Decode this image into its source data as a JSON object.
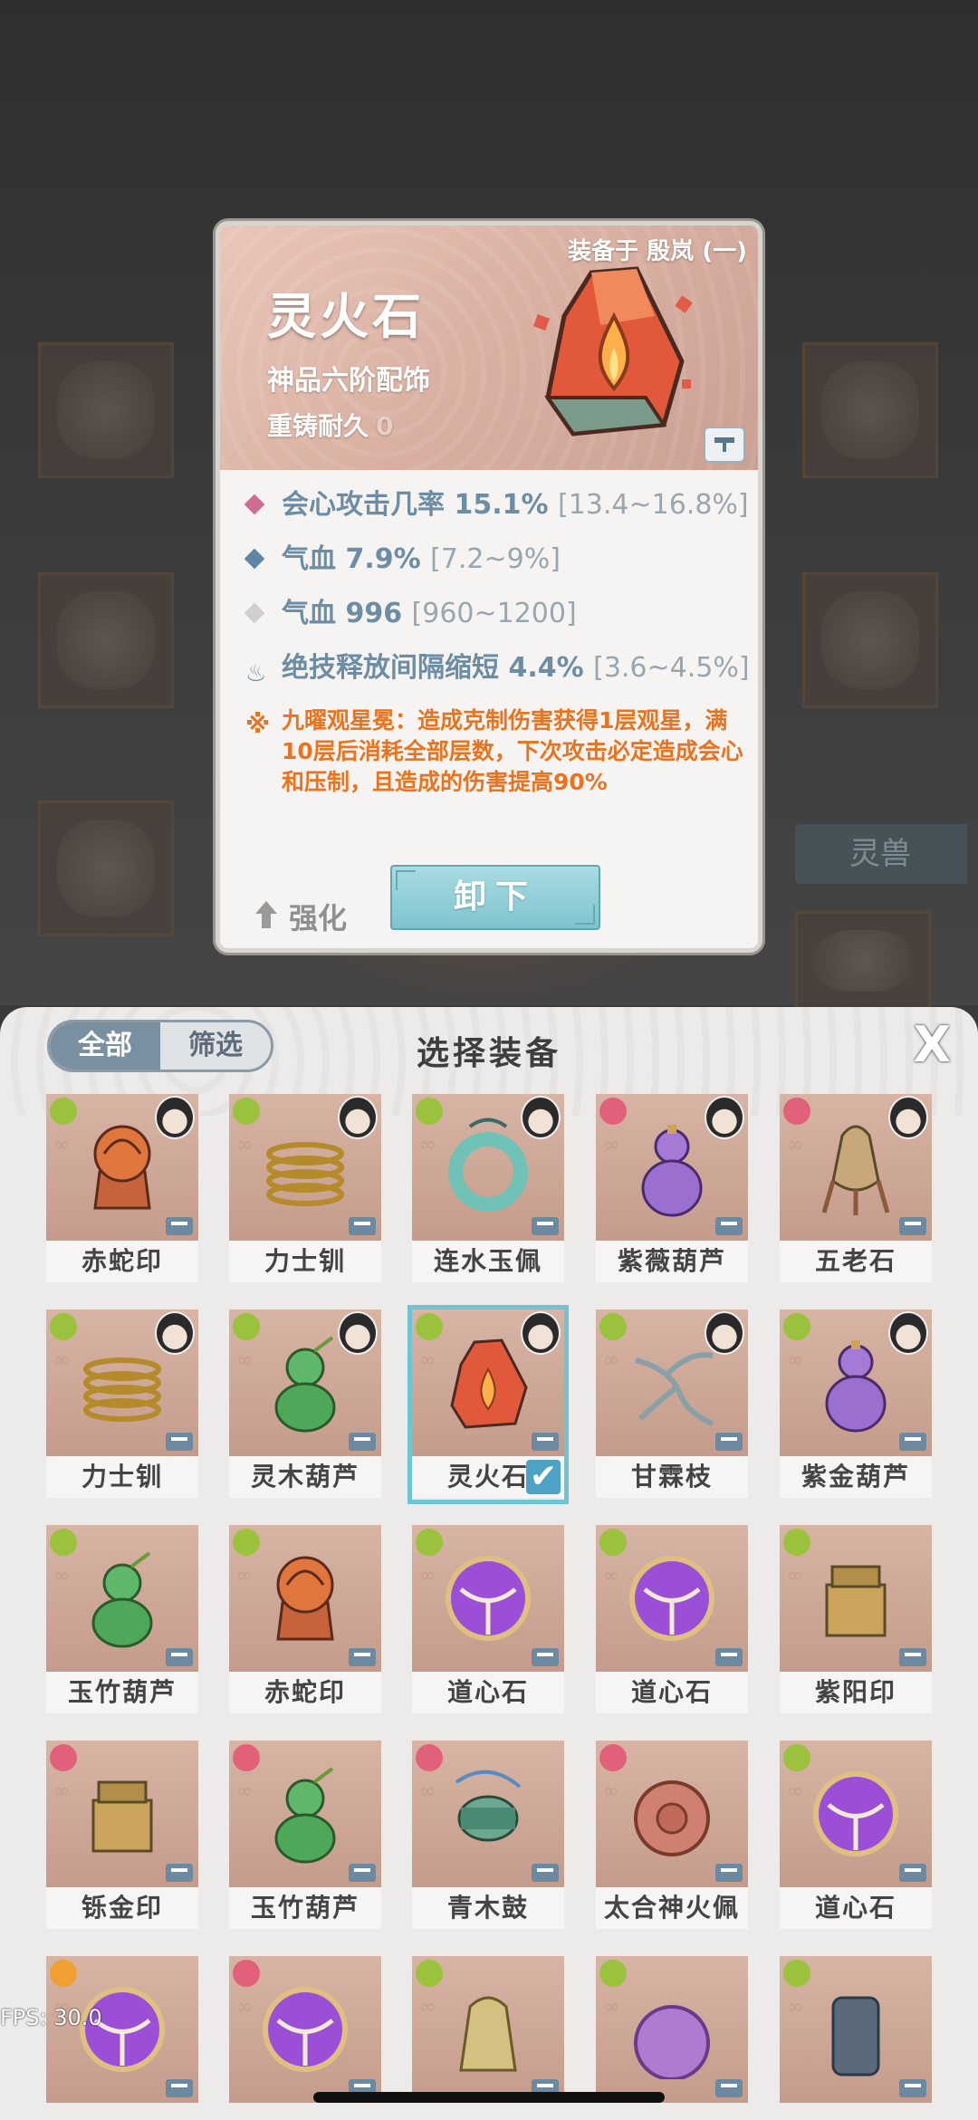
{
  "detail": {
    "equipped_by": "装备于 殷岚 (一)",
    "title": "灵火石",
    "grade": "神品六阶配饰",
    "durability_label": "重铸耐久",
    "durability_value": "0",
    "stats": [
      {
        "label": "会心攻击几率 15.1%",
        "range": "[13.4~16.8%]",
        "icon": "pink-diamond-icon",
        "color": "#d06b92"
      },
      {
        "label": "气血 7.9%",
        "range": "[7.2~9%]",
        "icon": "blue-diamond-icon",
        "color": "#5f86a8"
      },
      {
        "label": "气血 996",
        "range": "[960~1200]",
        "icon": "gray-diamond-icon",
        "color": "#cfcfcf"
      },
      {
        "label": "绝技释放间隔缩短 4.4%",
        "range": "[3.6~4.5%]",
        "icon": "flame-icon",
        "color": "#6d8da5"
      }
    ],
    "effect": "九曜观星冕：造成克制伤害获得1层观星，满10层后消耗全部层数，下次攻击必定造成会心和压制，且造成的伤害提高90%",
    "upgrade_label": "强化",
    "unequip_label": "卸下"
  },
  "background": {
    "side_tab": "灵兽"
  },
  "sheet": {
    "tab_all": "全部",
    "tab_filter": "筛选",
    "title": "选择装备",
    "close": "X",
    "items": [
      {
        "name": "赤蛇印",
        "grade_color": "#9ac23c",
        "avatar": true,
        "art": "orange-seal"
      },
      {
        "name": "力士钏",
        "grade_color": "#9ac23c",
        "avatar": true,
        "art": "gold-coil"
      },
      {
        "name": "连水玉佩",
        "grade_color": "#9ac23c",
        "avatar": true,
        "art": "jade-ring"
      },
      {
        "name": "紫薇葫芦",
        "grade_color": "#e2617a",
        "avatar": true,
        "art": "purple-gourd"
      },
      {
        "name": "五老石",
        "grade_color": "#e2617a",
        "avatar": true,
        "art": "yellow-stone"
      },
      {
        "name": "力士钏",
        "grade_color": "#9ac23c",
        "avatar": true,
        "art": "gold-coil"
      },
      {
        "name": "灵木葫芦",
        "grade_color": "#9ac23c",
        "avatar": true,
        "art": "green-gourd"
      },
      {
        "name": "灵火石",
        "grade_color": "#9ac23c",
        "avatar": true,
        "art": "fire-stone",
        "selected": true
      },
      {
        "name": "甘霖枝",
        "grade_color": "#9ac23c",
        "avatar": true,
        "art": "branch"
      },
      {
        "name": "紫金葫芦",
        "grade_color": "#9ac23c",
        "avatar": true,
        "art": "purple-gourd"
      },
      {
        "name": "玉竹葫芦",
        "grade_color": "#9ac23c",
        "avatar": false,
        "art": "green-gourd"
      },
      {
        "name": "赤蛇印",
        "grade_color": "#9ac23c",
        "avatar": false,
        "art": "orange-seal"
      },
      {
        "name": "道心石",
        "grade_color": "#9ac23c",
        "avatar": false,
        "art": "purple-orb"
      },
      {
        "name": "道心石",
        "grade_color": "#9ac23c",
        "avatar": false,
        "art": "purple-orb"
      },
      {
        "name": "紫阳印",
        "grade_color": "#9ac23c",
        "avatar": false,
        "art": "box-seal"
      },
      {
        "name": "铄金印",
        "grade_color": "#e2617a",
        "avatar": false,
        "art": "box-seal"
      },
      {
        "name": "玉竹葫芦",
        "grade_color": "#e2617a",
        "avatar": false,
        "art": "green-gourd"
      },
      {
        "name": "青木鼓",
        "grade_color": "#e2617a",
        "avatar": false,
        "art": "drum"
      },
      {
        "name": "太合神火佩",
        "grade_color": "#e2617a",
        "avatar": false,
        "art": "red-pendant"
      },
      {
        "name": "道心石",
        "grade_color": "#9ac23c",
        "avatar": false,
        "art": "purple-orb"
      },
      {
        "name": "",
        "grade_color": "#f0a030",
        "avatar": false,
        "art": "purple-orb"
      },
      {
        "name": "",
        "grade_color": "#e2617a",
        "avatar": false,
        "art": "purple-orb"
      },
      {
        "name": "",
        "grade_color": "#9ac23c",
        "avatar": false,
        "art": "gold-pendant"
      },
      {
        "name": "",
        "grade_color": "#9ac23c",
        "avatar": false,
        "art": "purple-pendant"
      },
      {
        "name": "",
        "grade_color": "#9ac23c",
        "avatar": false,
        "art": "dark-seal"
      }
    ]
  },
  "fps": "FPS: 30.0"
}
